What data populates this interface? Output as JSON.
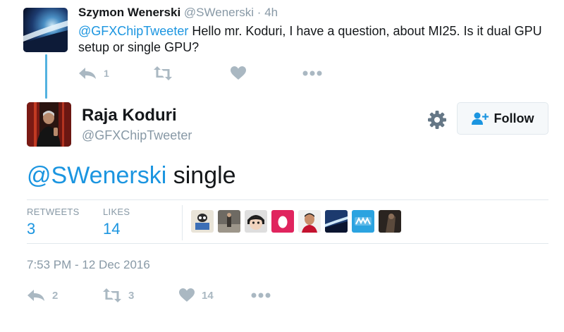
{
  "parent_tweet": {
    "author_name": "Szymon Wenerski",
    "author_handle": "@SWenerski",
    "separator": "·",
    "time": "4h",
    "text_mention": "@GFXChipTweeter",
    "text_body": " Hello mr. Koduri, I have a question, about MI25. Is it dual GPU setup or single GPU?",
    "actions": {
      "reply": {
        "icon": "reply-icon",
        "count": "1"
      },
      "retweet": {
        "icon": "retweet-icon",
        "count": ""
      },
      "like": {
        "icon": "heart-icon",
        "count": ""
      },
      "more": {
        "icon": "more-icon"
      }
    }
  },
  "main_tweet": {
    "author_name": "Raja Koduri",
    "author_handle": "@GFXChipTweeter",
    "follow_label": "Follow",
    "text_mention": "@SWenerski",
    "text_body": " single",
    "stats": {
      "retweets_label": "RETWEETS",
      "retweets_value": "3",
      "likes_label": "LIKES",
      "likes_value": "14"
    },
    "likers_count": 8,
    "timestamp": "7:53 PM - 12 Dec 2016",
    "actions": {
      "reply": {
        "icon": "reply-icon",
        "count": "2"
      },
      "retweet": {
        "icon": "retweet-icon",
        "count": "3"
      },
      "like": {
        "icon": "heart-icon",
        "count": "14"
      },
      "more": {
        "icon": "more-icon"
      }
    }
  },
  "colors": {
    "accent": "#1b95e0",
    "muted": "#8899a6",
    "icon": "#aab8c2",
    "thread_line": "#53b2e0",
    "divider": "#e1e8ed"
  }
}
